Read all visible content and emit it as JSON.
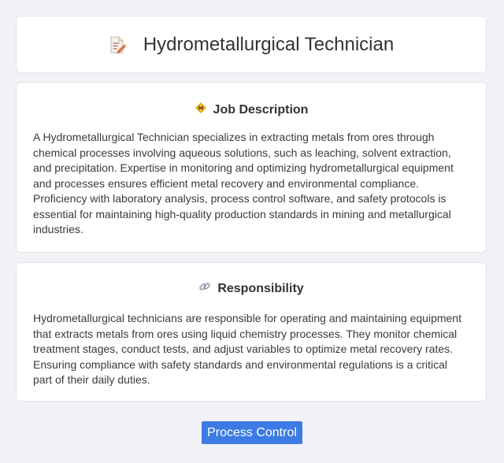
{
  "header": {
    "title": "Hydrometallurgical Technician",
    "icon": "document-edit-icon"
  },
  "job_description": {
    "heading": "Job Description",
    "icon": "diamond-badge-icon",
    "body": "A Hydrometallurgical Technician specializes in extracting metals from ores through chemical processes involving aqueous solutions, such as leaching, solvent extraction, and precipitation. Expertise in monitoring and optimizing hydrometallurgical equipment and processes ensures efficient metal recovery and environmental compliance. Proficiency with laboratory analysis, process control software, and safety protocols is essential for maintaining high-quality production standards in mining and metallurgical industries."
  },
  "responsibility": {
    "heading": "Responsibility",
    "icon": "link-icon",
    "body": "Hydrometallurgical technicians are responsible for operating and maintaining equipment that extracts metals from ores using liquid chemistry processes. They monitor chemical treatment stages, conduct tests, and adjust variables to optimize metal recovery rates. Ensuring compliance with safety standards and environmental regulations is a critical part of their daily duties."
  },
  "tag_button": {
    "label": "Process Control"
  },
  "colors": {
    "background": "#f1f2f6",
    "card": "#ffffff",
    "accent": "#3d7be4"
  }
}
